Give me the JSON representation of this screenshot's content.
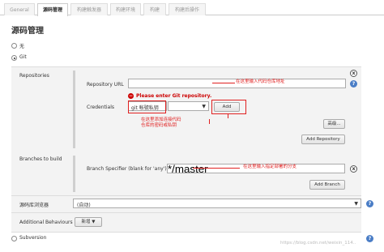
{
  "tabs": [
    {
      "label": "General"
    },
    {
      "label": "源码管理"
    },
    {
      "label": "构建触发器"
    },
    {
      "label": "构建环境"
    },
    {
      "label": "构建"
    },
    {
      "label": "构建后操作"
    }
  ],
  "section_title": "源码管理",
  "scm_options": {
    "none": "无",
    "git": "Git",
    "subversion": "Subversion"
  },
  "repositories": {
    "label": "Repositories",
    "url_label": "Repository URL",
    "url_value": "",
    "error_text": "Please enter Git repository.",
    "credentials_label": "Credentials",
    "credentials_selected": "git 帐號私钥",
    "credentials_second_select": "",
    "add_button": "Add",
    "advanced_button": "高级...",
    "add_repository_button": "Add Repository"
  },
  "branches": {
    "label": "Branches to build",
    "specifier_label": "Branch Specifier (blank for 'any')",
    "specifier_value": "*/master",
    "add_branch_button": "Add Branch"
  },
  "browser": {
    "label": "源码库浏览器",
    "selected": "(自动)"
  },
  "behaviours": {
    "label": "Additional Behaviours",
    "add_button": "新增"
  },
  "annotations": {
    "url": "在这里输入代码仓库地址",
    "credentials_line1": "在这里添加连接代码",
    "credentials_line2": "仓库的密码或私钥",
    "branch": "在这里输入指定部署的分支"
  },
  "watermark": "https://blog.csdn.net/weixin_114..",
  "icons": {
    "help": "?",
    "delete": "x",
    "dropdown": "▼",
    "error": "−"
  },
  "colors": {
    "error": "#cc0000",
    "annotation": "#e02020",
    "help": "#4a7dc6"
  }
}
